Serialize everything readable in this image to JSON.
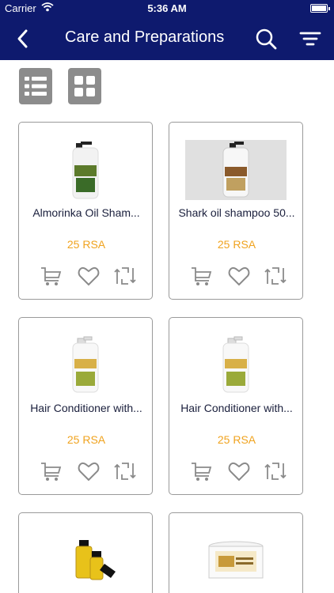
{
  "status": {
    "carrier": "Carrier",
    "time": "5:36 AM"
  },
  "nav": {
    "title": "Care and Preparations"
  },
  "products": [
    {
      "name": "Almorinka Oil Sham...",
      "price": "25 RSA"
    },
    {
      "name": "Shark oil shampoo 50...",
      "price": "25 RSA"
    },
    {
      "name": "Hair Conditioner with...",
      "price": "25 RSA"
    },
    {
      "name": "Hair Conditioner with...",
      "price": "25 RSA"
    }
  ],
  "colors": {
    "nav_bg": "#0e1a6e",
    "price": "#f0a31f",
    "toggle_bg": "#8c8c8c",
    "card_border": "#9a9a9a"
  }
}
